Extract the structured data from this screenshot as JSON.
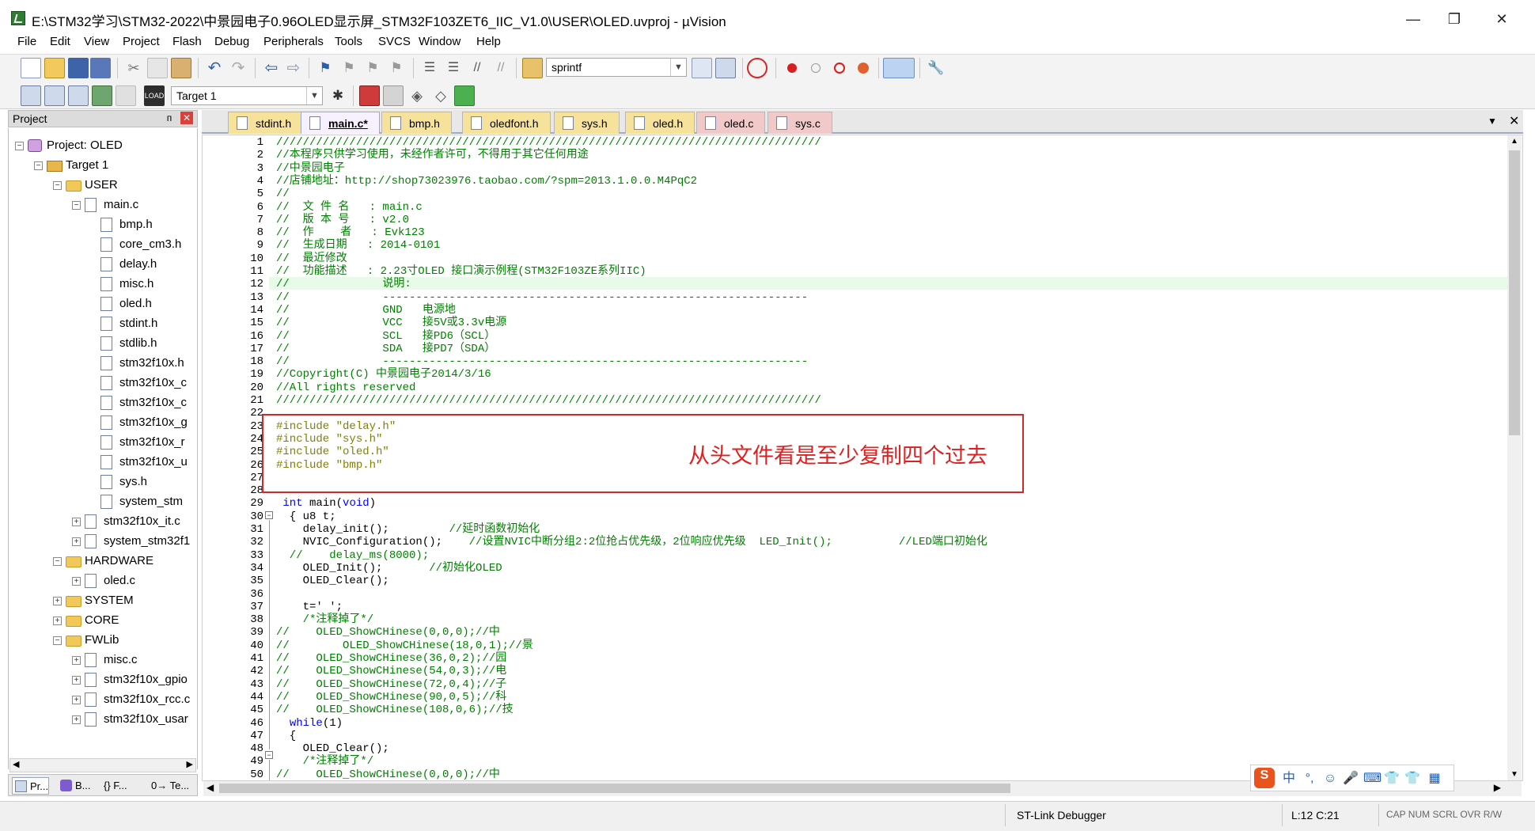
{
  "window": {
    "title": "E:\\STM32学习\\STM32-2022\\中景园电子0.96OLED显示屏_STM32F103ZET6_IIC_V1.0\\USER\\OLED.uvproj - µVision",
    "minimize": "—",
    "maximize": "❐",
    "close": "✕"
  },
  "menu": [
    "File",
    "Edit",
    "View",
    "Project",
    "Flash",
    "Debug",
    "Peripherals",
    "Tools",
    "SVCS",
    "Window",
    "Help"
  ],
  "toolbar": {
    "find_text": "sprintf",
    "target": "Target 1"
  },
  "project_panel": {
    "title": "Project",
    "pin": "ᴨ",
    "close": "✕",
    "tree": [
      {
        "label": "Project: OLED",
        "level": 0,
        "kind": "project",
        "exp": "−"
      },
      {
        "label": "Target 1",
        "level": 1,
        "kind": "target",
        "exp": "−"
      },
      {
        "label": "USER",
        "level": 2,
        "kind": "folder",
        "exp": "−"
      },
      {
        "label": "main.c",
        "level": 3,
        "kind": "file",
        "exp": "−"
      },
      {
        "label": "bmp.h",
        "level": 4,
        "kind": "file"
      },
      {
        "label": "core_cm3.h",
        "level": 4,
        "kind": "file"
      },
      {
        "label": "delay.h",
        "level": 4,
        "kind": "file"
      },
      {
        "label": "misc.h",
        "level": 4,
        "kind": "file"
      },
      {
        "label": "oled.h",
        "level": 4,
        "kind": "file"
      },
      {
        "label": "stdint.h",
        "level": 4,
        "kind": "file"
      },
      {
        "label": "stdlib.h",
        "level": 4,
        "kind": "file"
      },
      {
        "label": "stm32f10x.h",
        "level": 4,
        "kind": "file"
      },
      {
        "label": "stm32f10x_c",
        "level": 4,
        "kind": "file"
      },
      {
        "label": "stm32f10x_c",
        "level": 4,
        "kind": "file"
      },
      {
        "label": "stm32f10x_g",
        "level": 4,
        "kind": "file"
      },
      {
        "label": "stm32f10x_r",
        "level": 4,
        "kind": "file"
      },
      {
        "label": "stm32f10x_u",
        "level": 4,
        "kind": "file"
      },
      {
        "label": "sys.h",
        "level": 4,
        "kind": "file"
      },
      {
        "label": "system_stm",
        "level": 4,
        "kind": "file"
      },
      {
        "label": "stm32f10x_it.c",
        "level": 3,
        "kind": "file",
        "exp": "+"
      },
      {
        "label": "system_stm32f1",
        "level": 3,
        "kind": "file",
        "exp": "+"
      },
      {
        "label": "HARDWARE",
        "level": 2,
        "kind": "folder",
        "exp": "−"
      },
      {
        "label": "oled.c",
        "level": 3,
        "kind": "file",
        "exp": "+"
      },
      {
        "label": "SYSTEM",
        "level": 2,
        "kind": "folder",
        "exp": "+"
      },
      {
        "label": "CORE",
        "level": 2,
        "kind": "folder",
        "exp": "+"
      },
      {
        "label": "FWLib",
        "level": 2,
        "kind": "folder",
        "exp": "−"
      },
      {
        "label": "misc.c",
        "level": 3,
        "kind": "file",
        "exp": "+"
      },
      {
        "label": "stm32f10x_gpio",
        "level": 3,
        "kind": "file",
        "exp": "+"
      },
      {
        "label": "stm32f10x_rcc.c",
        "level": 3,
        "kind": "file",
        "exp": "+"
      },
      {
        "label": "stm32f10x_usar",
        "level": 3,
        "kind": "file",
        "exp": "+"
      }
    ],
    "bottom_tabs": [
      "Pr...",
      "B...",
      "{} F...",
      "0→ Te..."
    ]
  },
  "editor_tabs": [
    {
      "label": "stdint.h",
      "kind": "h"
    },
    {
      "label": "main.c*",
      "kind": "active"
    },
    {
      "label": "bmp.h",
      "kind": "h"
    },
    {
      "label": "oledfont.h",
      "kind": "h"
    },
    {
      "label": "sys.h",
      "kind": "h"
    },
    {
      "label": "oled.h",
      "kind": "h"
    },
    {
      "label": "oled.c",
      "kind": "c"
    },
    {
      "label": "sys.c",
      "kind": "c"
    }
  ],
  "code_lines": [
    {
      "n": "1",
      "t": "//////////////////////////////////////////////////////////////////////////////////",
      "c": "cmt"
    },
    {
      "n": "2",
      "t": "//本程序只供学习使用，未经作者许可，不得用于其它任何用途",
      "c": "cmt"
    },
    {
      "n": "3",
      "t": "//中景园电子",
      "c": "cmt"
    },
    {
      "n": "4",
      "t": "//店铺地址：http://shop73023976.taobao.com/?spm=2013.1.0.0.M4PqC2",
      "c": "cmt"
    },
    {
      "n": "5",
      "t": "//",
      "c": "cmt"
    },
    {
      "n": "6",
      "t": "//  文 件 名   : main.c",
      "c": "cmt"
    },
    {
      "n": "7",
      "t": "//  版 本 号   : v2.0",
      "c": "cmt"
    },
    {
      "n": "8",
      "t": "//  作    者   : Evk123",
      "c": "cmt"
    },
    {
      "n": "9",
      "t": "//  生成日期   : 2014-0101",
      "c": "cmt"
    },
    {
      "n": "10",
      "t": "//  最近修改",
      "c": "cmt"
    },
    {
      "n": "11",
      "t": "//  功能描述   : 2.23寸OLED 接口演示例程(STM32F103ZE系列IIC)",
      "c": "cmt"
    },
    {
      "n": "12",
      "t": "//              说明:",
      "c": "cmt"
    },
    {
      "n": "13",
      "t": "//              ----------------------------------------------------------------",
      "c": "cmt"
    },
    {
      "n": "14",
      "t": "//              GND   电源地",
      "c": "cmt"
    },
    {
      "n": "15",
      "t": "//              VCC   接5V或3.3v电源",
      "c": "cmt"
    },
    {
      "n": "16",
      "t": "//              SCL   接PD6（SCL）",
      "c": "cmt"
    },
    {
      "n": "17",
      "t": "//              SDA   接PD7（SDA）",
      "c": "cmt"
    },
    {
      "n": "18",
      "t": "//              ----------------------------------------------------------------",
      "c": "cmt"
    },
    {
      "n": "19",
      "t": "//Copyright(C) 中景园电子2014/3/16",
      "c": "cmt"
    },
    {
      "n": "20",
      "t": "//All rights reserved",
      "c": "cmt"
    },
    {
      "n": "21",
      "t": "//////////////////////////////////////////////////////////////////////////////////",
      "c": "cmt"
    },
    {
      "n": "22",
      "t": "",
      "c": "plain"
    },
    {
      "n": "23",
      "t": "#include \"delay.h\"",
      "c": "pp"
    },
    {
      "n": "24",
      "t": "#include \"sys.h\"",
      "c": "pp"
    },
    {
      "n": "25",
      "t": "#include \"oled.h\"",
      "c": "pp"
    },
    {
      "n": "26",
      "t": "#include \"bmp.h\"",
      "c": "pp"
    },
    {
      "n": "27",
      "t": "",
      "c": "plain"
    },
    {
      "n": "28",
      "t": "",
      "c": "plain"
    },
    {
      "n": "29",
      "t": " int main(void)",
      "c": "mainsig"
    },
    {
      "n": "30",
      "t": "  { u8 t;",
      "c": "plain"
    },
    {
      "n": "31",
      "t": "    delay_init();         //延时函数初始化",
      "c": "mixed"
    },
    {
      "n": "32",
      "t": "    NVIC_Configuration();    //设置NVIC中断分组2:2位抢占优先级，2位响应优先级  LED_Init();          //LED端口初始化",
      "c": "mixed"
    },
    {
      "n": "33",
      "t": "  //    delay_ms(8000);",
      "c": "cmt"
    },
    {
      "n": "34",
      "t": "    OLED_Init();       //初始化OLED",
      "c": "mixed"
    },
    {
      "n": "35",
      "t": "    OLED_Clear();",
      "c": "plain"
    },
    {
      "n": "36",
      "t": "",
      "c": "plain"
    },
    {
      "n": "37",
      "t": "    t=' ';",
      "c": "plain"
    },
    {
      "n": "38",
      "t": "    /*注释掉了*/",
      "c": "cmt"
    },
    {
      "n": "39",
      "t": "//    OLED_ShowCHinese(0,0,0);//中",
      "c": "cmt"
    },
    {
      "n": "40",
      "t": "//        OLED_ShowCHinese(18,0,1);//景",
      "c": "cmt"
    },
    {
      "n": "41",
      "t": "//    OLED_ShowCHinese(36,0,2);//园",
      "c": "cmt"
    },
    {
      "n": "42",
      "t": "//    OLED_ShowCHinese(54,0,3);//电",
      "c": "cmt"
    },
    {
      "n": "43",
      "t": "//    OLED_ShowCHinese(72,0,4);//子",
      "c": "cmt"
    },
    {
      "n": "44",
      "t": "//    OLED_ShowCHinese(90,0,5);//科",
      "c": "cmt"
    },
    {
      "n": "45",
      "t": "//    OLED_ShowCHinese(108,0,6);//技",
      "c": "cmt"
    },
    {
      "n": "46",
      "t": "  while(1)",
      "c": "while"
    },
    {
      "n": "47",
      "t": "  {",
      "c": "plain"
    },
    {
      "n": "48",
      "t": "    OLED_Clear();",
      "c": "plain"
    },
    {
      "n": "49",
      "t": "    /*注释掉了*/",
      "c": "cmt"
    },
    {
      "n": "50",
      "t": "//    OLED_ShowCHinese(0,0,0);//中",
      "c": "cmt"
    }
  ],
  "annotation": "从头文件看是至少复制四个过去",
  "ime": [
    "S",
    "中",
    "°,",
    "☺",
    "🎤",
    "⌨",
    "👕",
    "👕",
    "▦"
  ],
  "status": {
    "debugger": "ST-Link Debugger",
    "position": "L:12 C:21",
    "caps": "CAP  NUM  SCRL  OVR  R/W"
  },
  "colors": {
    "comment": "#008000",
    "preprocessor": "#808000",
    "keyword": "#0000ff",
    "annotation_red": "#e02020"
  }
}
